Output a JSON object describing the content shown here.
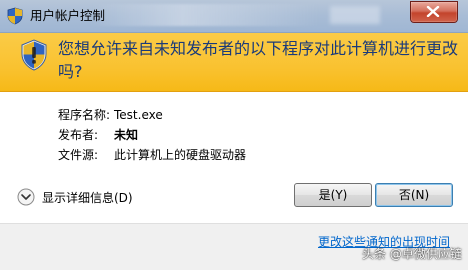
{
  "window": {
    "title": "用户帐户控制",
    "close_icon": "close-icon"
  },
  "banner": {
    "question": "您想允许来自未知发布者的以下程序对此计算机进行更改吗?",
    "icon": "uac-shield-icon"
  },
  "details": [
    {
      "label": "程序名称:",
      "value": "Test.exe",
      "bold": false
    },
    {
      "label": "发布者:",
      "value": "未知",
      "bold": true
    },
    {
      "label": "文件源:",
      "value": "此计算机上的硬盘驱动器",
      "bold": false
    }
  ],
  "expander": {
    "label": "显示详细信息(D)",
    "icon": "chevron-down-icon"
  },
  "buttons": {
    "yes_label": "是(Y)",
    "no_label": "否(N)"
  },
  "footer": {
    "settings_link": "更改这些通知的出现时间",
    "watermark": "头条 @卓微供应链"
  },
  "colors": {
    "banner": "#f9c230",
    "question_text": "#1a3a7a",
    "link": "#0066cc"
  }
}
